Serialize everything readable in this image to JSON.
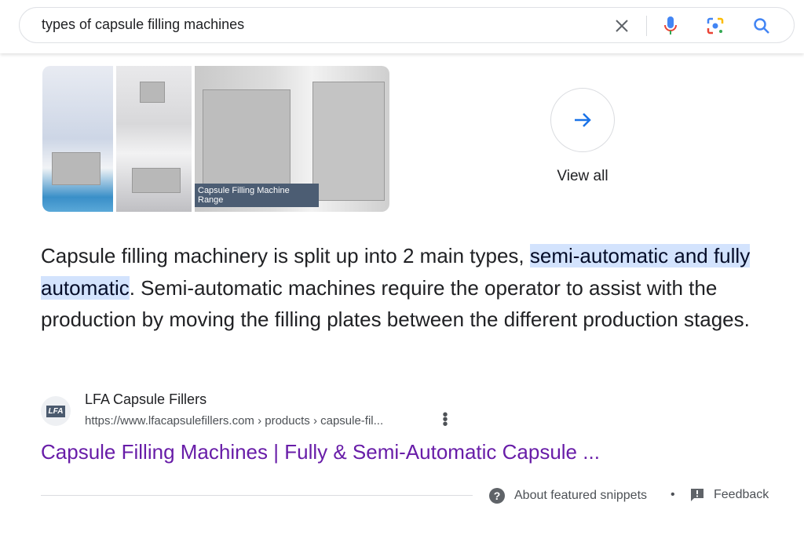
{
  "search": {
    "query": "types of capsule filling machines"
  },
  "images": {
    "caption": "Capsule Filling Machine Range",
    "view_all": "View all"
  },
  "snippet": {
    "before": "Capsule filling machinery is split up into 2 main types, ",
    "highlight": "semi-automatic and fully automatic",
    "after": ". Semi-automatic machines require the operator to assist with the production by moving the filling plates between the different production stages."
  },
  "source": {
    "site_name": "LFA Capsule Fillers",
    "url": "https://www.lfacapsulefillers.com › products › capsule-fil...",
    "title": "Capsule Filling Machines | Fully & Semi-Automatic Capsule ...",
    "favicon_text": "LFA"
  },
  "footer": {
    "about": "About featured snippets",
    "separator": "•",
    "feedback": "Feedback"
  },
  "colors": {
    "link": "#681da8",
    "highlight": "#d3e3fd",
    "accent": "#4285f4"
  }
}
